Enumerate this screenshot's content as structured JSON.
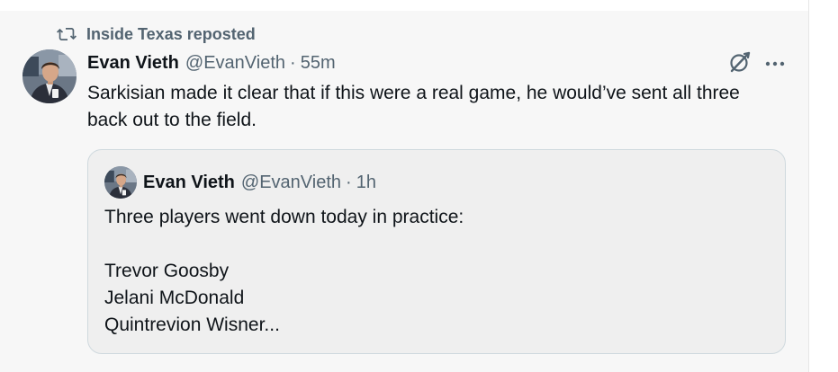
{
  "social_context": {
    "label": "Inside Texas reposted",
    "icon": "repost-icon"
  },
  "tweet": {
    "author_name": "Evan Vieth",
    "author_handle": "@EvanVieth",
    "separator": "·",
    "time": "55m",
    "text": "Sarkisian made it clear that if this were a real game, he would’ve sent all three back out to the field.",
    "actions": {
      "grok_icon": "grok-icon",
      "more_icon": "more-icon"
    }
  },
  "quote": {
    "author_name": "Evan Vieth",
    "author_handle": "@EvanVieth",
    "separator": "·",
    "time": "1h",
    "lines": [
      "Three players went down today in practice:",
      "",
      "Trevor Goosby",
      "Jelani McDonald",
      "Quintrevion Wisner..."
    ]
  },
  "colors": {
    "text_primary": "#0f1419",
    "text_secondary": "#536471",
    "background": "#f7f7f7",
    "quote_background": "#efefef",
    "border": "#cfd9de"
  }
}
